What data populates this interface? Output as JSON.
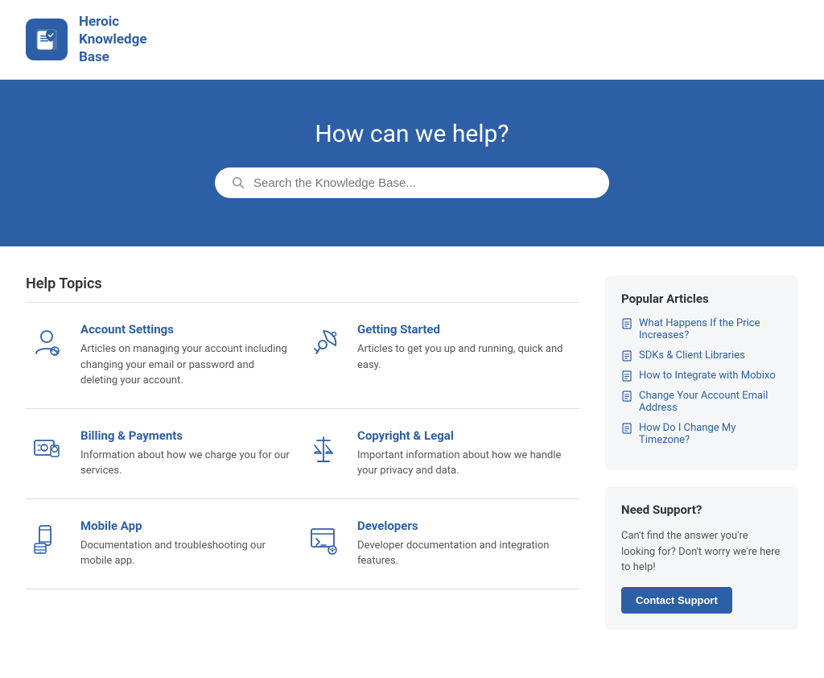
{
  "header": {
    "brand_name": "Heroic\nKnowledge\nBase"
  },
  "hero": {
    "title": "How can we help?",
    "search_placeholder": "Search the Knowledge Base..."
  },
  "content": {
    "section_title": "Help Topics",
    "topics": [
      {
        "row": 0,
        "name": "Account Settings",
        "desc": "Articles on managing your account including changing your email or password and deleting your account.",
        "icon": "account"
      },
      {
        "row": 0,
        "name": "Getting Started",
        "desc": "Articles to get you up and running, quick and easy.",
        "icon": "rocket"
      },
      {
        "row": 1,
        "name": "Billing & Payments",
        "desc": "Information about how we charge you for our services.",
        "icon": "billing"
      },
      {
        "row": 1,
        "name": "Copyright & Legal",
        "desc": "Important information about how we handle your privacy and data.",
        "icon": "legal"
      },
      {
        "row": 2,
        "name": "Mobile App",
        "desc": "Documentation and troubleshooting our mobile app.",
        "icon": "mobile"
      },
      {
        "row": 2,
        "name": "Developers",
        "desc": "Developer documentation and integration features.",
        "icon": "developers"
      }
    ]
  },
  "sidebar": {
    "popular_title": "Popular Articles",
    "popular_articles": [
      "What Happens If the Price Increases?",
      "SDKs & Client Libraries",
      "How to Integrate with Mobixo",
      "Change Your Account Email Address",
      "How Do I Change My Timezone?"
    ],
    "support_title": "Need Support?",
    "support_desc": "Can't find the answer you're looking for? Don't worry we're here to help!",
    "contact_label": "Contact Support"
  }
}
